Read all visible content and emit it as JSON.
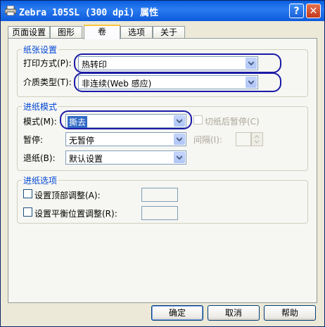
{
  "window": {
    "title": "Zebra 105SL (300 dpi) 属性",
    "help_label": "?",
    "close_label": "✕"
  },
  "tabs": [
    {
      "label": "页面设置",
      "active": false
    },
    {
      "label": "图形",
      "active": false
    },
    {
      "label": "卷",
      "active": true
    },
    {
      "label": "选项",
      "active": false
    },
    {
      "label": "关于",
      "active": false
    }
  ],
  "paper": {
    "legend": "纸张设置",
    "print_method_label": "打印方式(P):",
    "print_method_value": "热转印",
    "media_type_label": "介质类型(T):",
    "media_type_value": "非连续(Web 感应)"
  },
  "feed_mode": {
    "legend": "进纸模式",
    "mode_label": "模式(M):",
    "mode_value": "撕去",
    "cut_pause_label": "切纸后暂停(C)",
    "pause_label": "暂停:",
    "pause_value": "无暂停",
    "interval_label": "间隔(I):",
    "backfeed_label": "退纸(B):",
    "backfeed_value": "默认设置"
  },
  "feed_options": {
    "legend": "进纸选项",
    "top_adjust_label": "设置顶部调整(A):",
    "balance_adjust_label": "设置平衡位置调整(R):"
  },
  "buttons": {
    "ok": "确定",
    "cancel": "取消",
    "help": "帮助"
  },
  "colors": {
    "title_bar": "#0A5FE0",
    "legend_text": "#0046D5",
    "highlight_oval": "#1A1AA8",
    "selection": "#316AC5"
  }
}
